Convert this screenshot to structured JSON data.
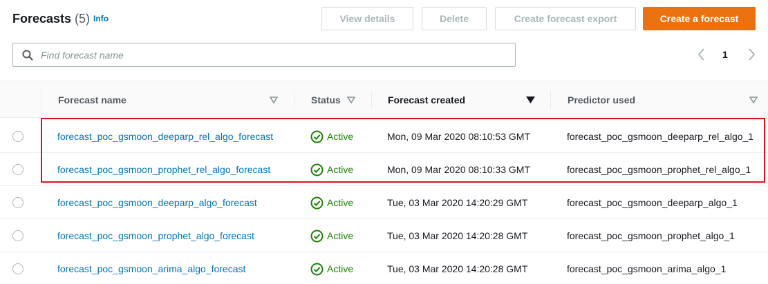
{
  "header": {
    "title": "Forecasts",
    "count": "(5)",
    "info": "Info"
  },
  "toolbar": {
    "view_details": "View details",
    "delete": "Delete",
    "create_export": "Create forecast export",
    "create_forecast": "Create a forecast"
  },
  "search": {
    "placeholder": "Find forecast name",
    "value": ""
  },
  "pagination": {
    "current_page": "1"
  },
  "columns": {
    "name": "Forecast name",
    "status": "Status",
    "created": "Forecast created",
    "predictor": "Predictor used"
  },
  "rows": [
    {
      "name": "forecast_poc_gsmoon_deeparp_rel_algo_forecast",
      "status": "Active",
      "created": "Mon, 09 Mar 2020 08:10:53 GMT",
      "predictor": "forecast_poc_gsmoon_deeparp_rel_algo_1"
    },
    {
      "name": "forecast_poc_gsmoon_prophet_rel_algo_forecast",
      "status": "Active",
      "created": "Mon, 09 Mar 2020 08:10:33 GMT",
      "predictor": "forecast_poc_gsmoon_prophet_rel_algo_1"
    },
    {
      "name": "forecast_poc_gsmoon_deeparp_algo_forecast",
      "status": "Active",
      "created": "Tue, 03 Mar 2020 14:20:29 GMT",
      "predictor": "forecast_poc_gsmoon_deeparp_algo_1"
    },
    {
      "name": "forecast_poc_gsmoon_prophet_algo_forecast",
      "status": "Active",
      "created": "Tue, 03 Mar 2020 14:20:28 GMT",
      "predictor": "forecast_poc_gsmoon_prophet_algo_1"
    },
    {
      "name": "forecast_poc_gsmoon_arima_algo_forecast",
      "status": "Active",
      "created": "Tue, 03 Mar 2020 14:20:28 GMT",
      "predictor": "forecast_poc_gsmoon_arima_algo_1"
    }
  ],
  "colors": {
    "accent": "#ec7211",
    "link": "#0073bb",
    "success": "#1d8102",
    "highlight": "#e0111b"
  },
  "icons": {
    "search": "search-icon",
    "status": "check-circle-icon",
    "prev": "chevron-left-icon",
    "next": "chevron-right-icon",
    "sort": "caret-down-icon"
  }
}
